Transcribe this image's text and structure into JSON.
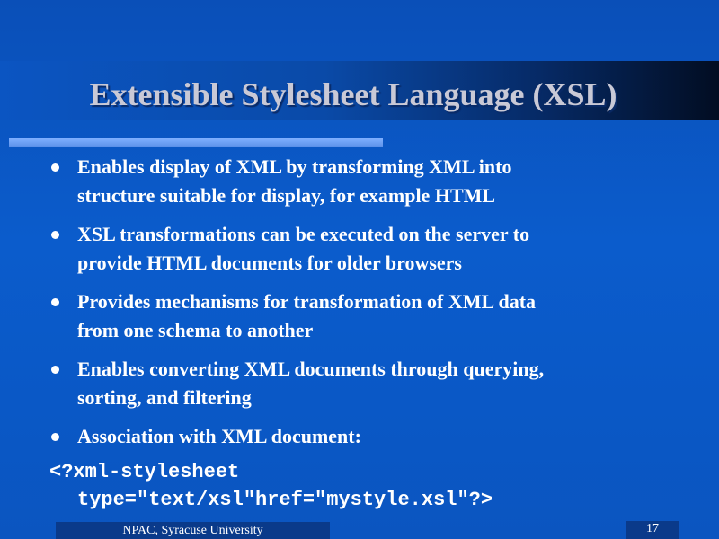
{
  "slide": {
    "title": "Extensible Stylesheet Language (XSL)",
    "bullets": [
      {
        "line1": "Enables display of XML by transforming XML into",
        "line2": "structure suitable for display, for example HTML"
      },
      {
        "line1": "XSL transformations can be executed on the server to",
        "line2": "provide HTML documents for older browsers"
      },
      {
        "line1": "Provides  mechanisms for transformation of XML data",
        "line2": "from one schema to another"
      },
      {
        "line1": "Enables converting XML documents through querying,",
        "line2": "sorting, and filtering"
      },
      {
        "line1": "Association with XML document:",
        "line2": ""
      }
    ],
    "code": {
      "line1": "<?xml-stylesheet",
      "line2": "type=\"text/xsl\"href=\"mystyle.xsl\"?>"
    },
    "footer": "NPAC, Syracuse University",
    "page_number": "17"
  },
  "colors": {
    "background": "#0b57c4",
    "title_text": "#c9c9d6",
    "body_text": "#ffffff"
  }
}
